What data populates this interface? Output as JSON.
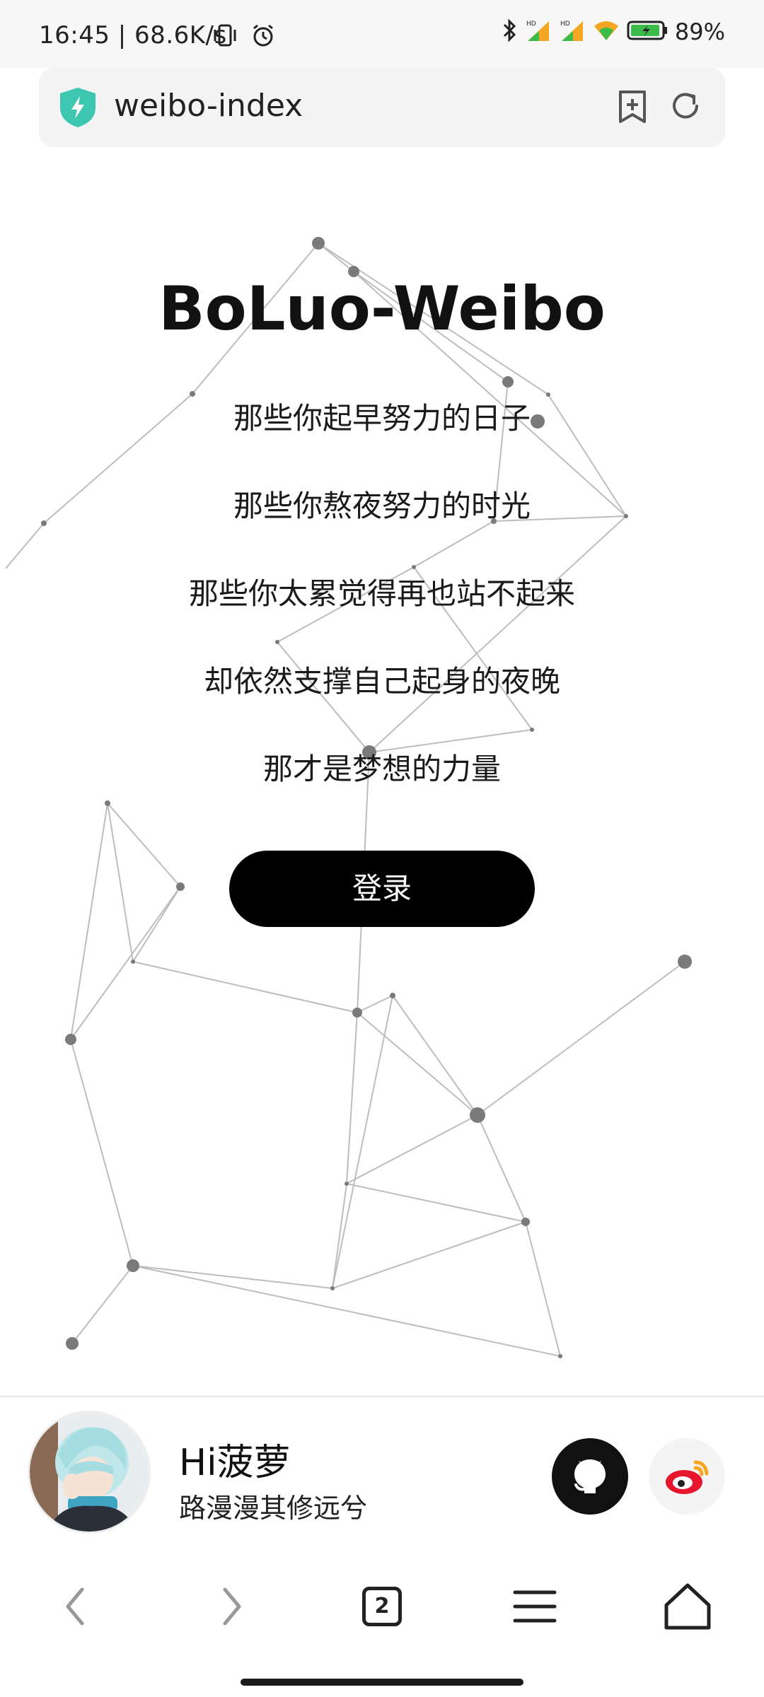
{
  "status_bar": {
    "time_speed": "16:45 | 68.6K/s",
    "battery": "89%",
    "icons": [
      "vibrate-icon",
      "alarm-icon",
      "bluetooth-icon",
      "signal-hd-icon",
      "signal-hd-icon",
      "wifi-icon",
      "battery-icon"
    ]
  },
  "browser": {
    "url": "weibo-index",
    "tab_count": "2"
  },
  "main": {
    "title": "BoLuo-Weibo",
    "slogans": [
      "那些你起早努力的日子",
      "那些你熬夜努力的时光",
      "那些你太累觉得再也站不起来",
      "却依然支撑自己起身的夜晚",
      "那才是梦想的力量"
    ],
    "login_label": "登录"
  },
  "profile": {
    "name": "Hi菠萝",
    "motto": "路漫漫其修远兮"
  },
  "colors": {
    "shield": "#3dc7b0",
    "network_line": "#bdbdbd",
    "network_node": "#7a7a7a",
    "button_bg": "#000000",
    "weibo_red": "#e6162d",
    "weibo_yellow": "#f5a623"
  }
}
